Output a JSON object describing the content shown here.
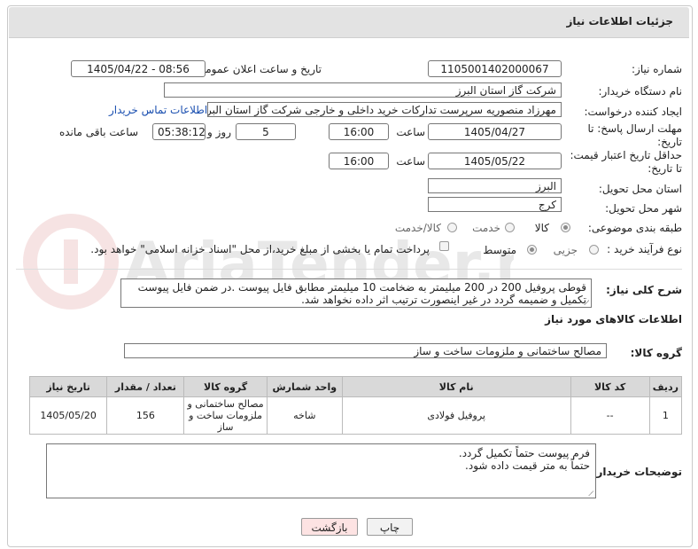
{
  "header": {
    "title": "جزئیات اطلاعات نیاز"
  },
  "fields": {
    "need_number_label": "شماره نیاز:",
    "need_number": "1105001402000067",
    "announce_label": "تاریخ و ساعت اعلان عمومی:",
    "announce_value": "1405/04/22 - 08:56",
    "buyer_org_label": "نام دستگاه خریدار:",
    "buyer_org": "شرکت گاز استان البرز",
    "creator_label": "ایجاد کننده درخواست:",
    "creator": "مهرزاد منصوریه سرپرست تدارکات خرید داخلی و خارجی شرکت گاز استان البرز",
    "contact_link": "اطلاعات تماس خریدار",
    "deadline_label_1": "مهلت ارسال پاسخ: تا",
    "deadline_label_2": "تاریخ:",
    "deadline_date": "1405/04/27",
    "time_label": "ساعت",
    "deadline_time": "16:00",
    "days_value": "5",
    "days_label": "روز و",
    "remaining_time": "05:38:12",
    "remaining_label": "ساعت باقی مانده",
    "validity_label_1": "حداقل تاریخ اعتبار قیمت:",
    "validity_label_2": "تا تاریخ:",
    "validity_date": "1405/05/22",
    "validity_time_label": "ساعت",
    "validity_time": "16:00",
    "province_label": "استان محل تحویل:",
    "province": "البرز",
    "city_label": "شهر محل تحویل:",
    "city": "کرج",
    "category_label": "طبقه بندی موضوعی:",
    "category_options": [
      "کالا",
      "خدمت",
      "کالا/خدمت"
    ],
    "process_label": "نوع فرآیند خرید :",
    "process_options": [
      "جزیی",
      "متوسط"
    ],
    "payment_note": "پرداخت تمام یا بخشی از مبلغ خرید،از محل \"اسناد خزانه اسلامی\" خواهد بود."
  },
  "description": {
    "label": "شرح کلی نیاز:",
    "text": "قوطی پروفیل 200 در 200 میلیمتر به ضخامت 10 میلیمتر مطابق فایل پیوست .در ضمن فایل پیوست تکمیل و ضمیمه گردد در غیر اینصورت ترتیب اثر داده نخواهد شد."
  },
  "goods_section": {
    "title": "اطلاعات کالاهای مورد نیاز",
    "group_label": "گروه کالا:",
    "group_value": "مصالح ساختمانی و ملزومات ساخت و ساز"
  },
  "table": {
    "headers": [
      "ردیف",
      "کد کالا",
      "نام کالا",
      "واحد شمارش",
      "گروه کالا",
      "تعداد / مقدار",
      "تاریخ نیاز"
    ],
    "rows": [
      [
        "1",
        "--",
        "پروفیل فولادی",
        "شاخه",
        "مصالح ساختمانی و ملزومات ساخت و ساز",
        "156",
        "1405/05/20"
      ]
    ]
  },
  "notes": {
    "label": "توضیحات خریدار:",
    "line1": "فرم پیوست حتماً تکمیل گردد.",
    "line2": "حتماً به متر قیمت داده شود."
  },
  "buttons": {
    "print": "چاپ",
    "back": "بازگشت"
  },
  "watermark": "AriaTender.net"
}
